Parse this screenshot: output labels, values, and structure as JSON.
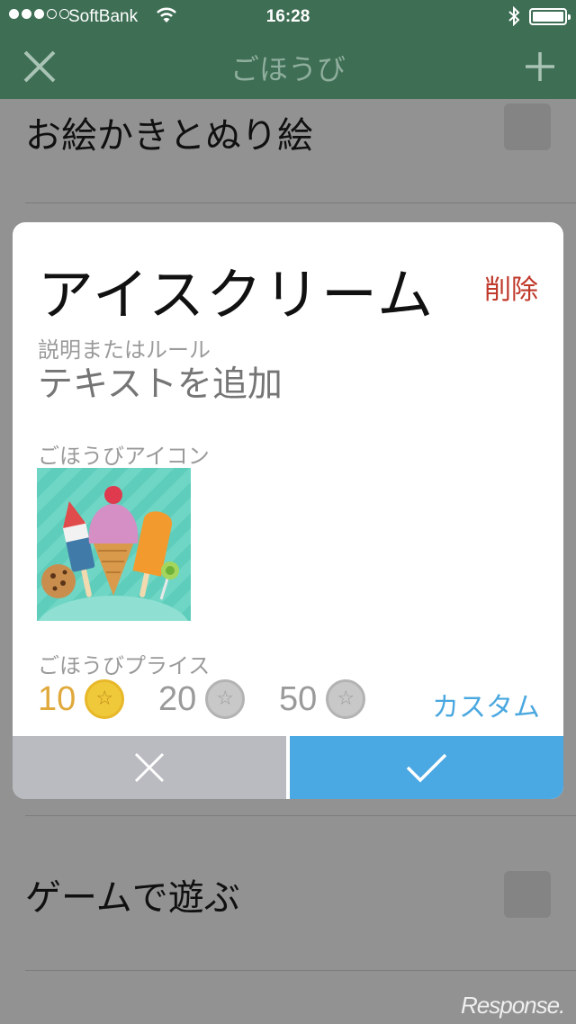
{
  "status_bar": {
    "carrier": "SoftBank",
    "time": "16:28"
  },
  "nav": {
    "title": "ごほうび"
  },
  "list": {
    "items": [
      {
        "label": "お絵かきとぬり絵"
      },
      {
        "label": "ゲームで遊ぶ"
      }
    ]
  },
  "dialog": {
    "title": "アイスクリーム",
    "delete_label": "削除",
    "description_label": "説明またはルール",
    "description_placeholder": "テキストを追加",
    "icon_label": "ごほうびアイコン",
    "icon_name": "ice-cream-icon",
    "price_label": "ごほうびプライス",
    "prices": [
      {
        "value": "10",
        "selected": true
      },
      {
        "value": "20",
        "selected": false
      },
      {
        "value": "50",
        "selected": false
      }
    ],
    "custom_label": "カスタム"
  },
  "watermark": "Response.",
  "colors": {
    "header": "#3e6e54",
    "delete": "#c0392b",
    "link": "#4aa8e0",
    "confirm": "#4aa8e3",
    "cancel": "#b9bbc1",
    "selected_price": "#e0a93c"
  }
}
